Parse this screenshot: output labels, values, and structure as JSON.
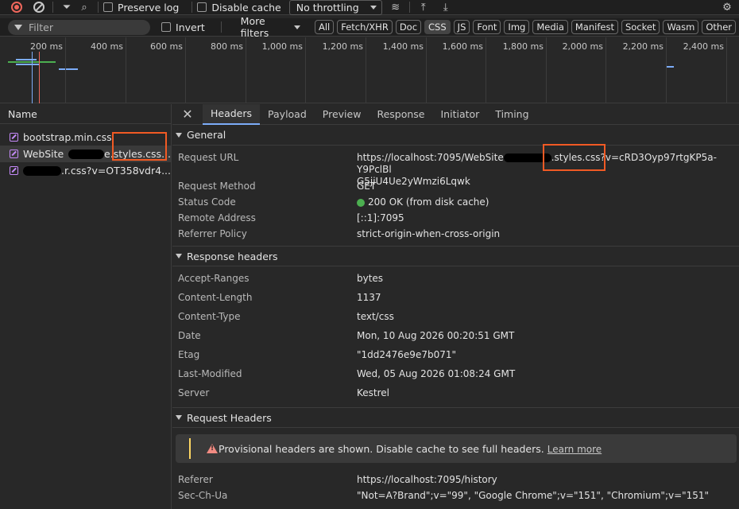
{
  "toolbar": {
    "preserve_log": "Preserve log",
    "disable_cache": "Disable cache",
    "throttling": "No throttling"
  },
  "filterbar": {
    "filter_placeholder": "Filter",
    "invert": "Invert",
    "more_filters": "More filters",
    "types": [
      "All",
      "Fetch/XHR",
      "Doc",
      "CSS",
      "JS",
      "Font",
      "Img",
      "Media",
      "Manifest",
      "Socket",
      "Wasm",
      "Other"
    ],
    "active_type": "CSS"
  },
  "timeline": {
    "ticks": [
      "200 ms",
      "400 ms",
      "600 ms",
      "800 ms",
      "1,000 ms",
      "1,200 ms",
      "1,400 ms",
      "1,600 ms",
      "1,800 ms",
      "2,000 ms",
      "2,200 ms",
      "2,400 ms"
    ]
  },
  "request_list": {
    "header": "Name",
    "items": [
      {
        "name": "bootstrap.min.css"
      },
      {
        "name_prefix": "WebSite",
        "name_suffix": "e.styles.css..."
      },
      {
        "name_suffix": ".r.css?v=OT358vdr4..."
      }
    ]
  },
  "details": {
    "tabs": [
      "Headers",
      "Payload",
      "Preview",
      "Response",
      "Initiator",
      "Timing"
    ],
    "active_tab": "Headers",
    "general": {
      "title": "General",
      "request_url_label": "Request URL",
      "request_url_line1_prefix": "https://localhost:7095/WebSite",
      "request_url_line1_suffix": ".styles.css?v=cRD3Oyp97rtgKP5a-Y9PclBl",
      "request_url_line2": "G5jiU4Ue2yWmzi6Lqwk",
      "request_method_label": "Request Method",
      "request_method": "GET",
      "status_code_label": "Status Code",
      "status_code": "200 OK (from disk cache)",
      "remote_address_label": "Remote Address",
      "remote_address": "[::1]:7095",
      "referrer_policy_label": "Referrer Policy",
      "referrer_policy": "strict-origin-when-cross-origin"
    },
    "response_headers": {
      "title": "Response headers",
      "rows": [
        {
          "k": "Accept-Ranges",
          "v": "bytes"
        },
        {
          "k": "Content-Length",
          "v": "1137"
        },
        {
          "k": "Content-Type",
          "v": "text/css"
        },
        {
          "k": "Date",
          "v": "Mon, 10 Aug 2026 00:20:51 GMT"
        },
        {
          "k": "Etag",
          "v": "\"1dd2476e9e7b071\""
        },
        {
          "k": "Last-Modified",
          "v": "Wed, 05 Aug 2026 01:08:24 GMT"
        },
        {
          "k": "Server",
          "v": "Kestrel"
        }
      ]
    },
    "request_headers": {
      "title": "Request Headers",
      "warning": "Provisional headers are shown. Disable cache to see full headers.",
      "learn_more": "Learn more",
      "rows": [
        {
          "k": "Referer",
          "v": "https://localhost:7095/history"
        },
        {
          "k": "Sec-Ch-Ua",
          "v": "\"Not=A?Brand\";v=\"99\", \"Google Chrome\";v=\"151\", \"Chromium\";v=\"151\""
        }
      ]
    }
  },
  "colors": {
    "highlight": "#f15a24",
    "status_ok": "#4caf50",
    "record": "#ee675c",
    "css_icon": "#c58af9"
  }
}
